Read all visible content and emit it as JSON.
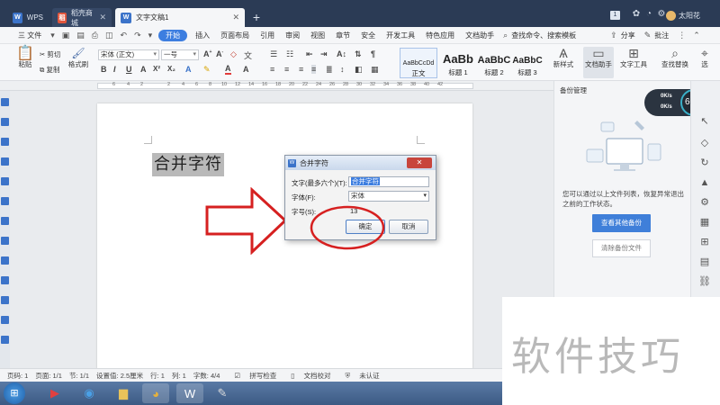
{
  "tabs": [
    {
      "label": "WPS",
      "icon": "W"
    },
    {
      "label": "稻壳商城",
      "icon": "稻"
    },
    {
      "label": "文字文稿1",
      "icon": "W",
      "active": true
    }
  ],
  "new_tab": "+",
  "user": {
    "name": "太阳花",
    "badge": "1"
  },
  "menu": {
    "file": "三 文件",
    "items": [
      "开始",
      "插入",
      "页面布局",
      "引用",
      "审阅",
      "视图",
      "章节",
      "安全",
      "开发工具",
      "特色应用",
      "文档助手"
    ],
    "search": "查找命令、搜索模板",
    "share": "分享",
    "comment": "批注"
  },
  "ribbon": {
    "paste": "粘贴",
    "cut": "剪切",
    "copy": "复制",
    "format_painter": "格式刷",
    "font_name": "宋体 (正文)",
    "font_size": "一号",
    "bold": "B",
    "italic": "I",
    "underline": "U",
    "styles": [
      {
        "preview": "AaBbCcDd",
        "label": "正文"
      },
      {
        "preview": "AaBb",
        "label": "标题 1"
      },
      {
        "preview": "AaBbC",
        "label": "标题 2"
      },
      {
        "preview": "AaBbC",
        "label": "标题 3"
      }
    ],
    "new_style": "新样式",
    "doc_assistant": "文档助手",
    "text_tools": "文字工具",
    "find_replace": "查找替换",
    "select": "选"
  },
  "ruler_marks": [
    "6",
    "4",
    "2",
    "2",
    "4",
    "6",
    "8",
    "10",
    "12",
    "14",
    "16",
    "18",
    "20",
    "22",
    "24",
    "26",
    "28",
    "30",
    "32",
    "34",
    "36",
    "38",
    "40",
    "42"
  ],
  "document": {
    "text": "合并字符"
  },
  "dialog": {
    "title": "合并字符",
    "close": "✕",
    "text_label": "文字(最多六个)(T):",
    "text_value": "合并字符",
    "font_label": "字体(F):",
    "font_value": "宋体",
    "size_label": "字号(S):",
    "size_value": "13",
    "ok": "确定",
    "cancel": "取消"
  },
  "right_panel": {
    "title": "备份管理",
    "message": "您可以通过以上文件列表，恢复异常退出之前的工作状态。",
    "view_other": "查看其他备份",
    "clear": "清除备份文件"
  },
  "speed_widget": {
    "percent": "60%",
    "up": "0K/s",
    "down": "0K/s"
  },
  "status_bar": {
    "page_no": "页码: 1",
    "pages": "页面: 1/1",
    "section": "节: 1/1",
    "setting": "设置值: 2.5厘米",
    "row": "行: 1",
    "col": "列: 1",
    "words": "字数: 4/4",
    "spell": "拼写检查",
    "proof": "文档校对",
    "auth": "未认证"
  },
  "watermark": "软件技巧"
}
